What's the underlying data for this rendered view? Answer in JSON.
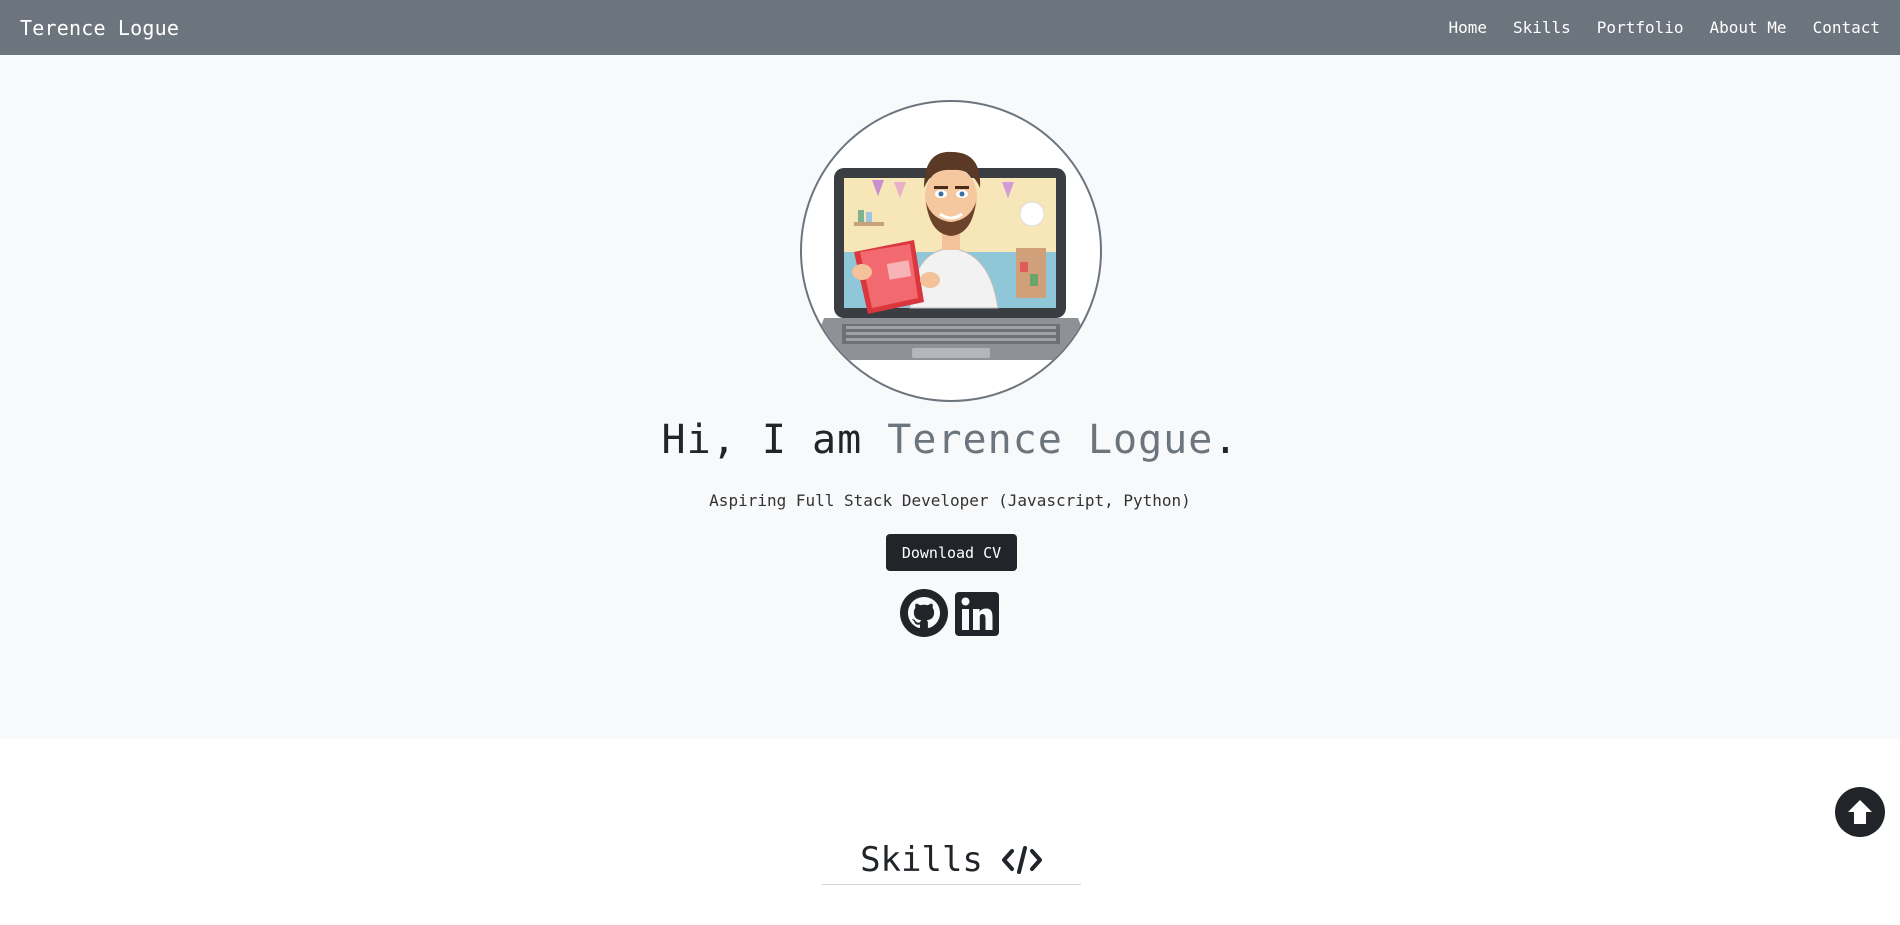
{
  "navbar": {
    "brand": "Terence Logue",
    "links": [
      {
        "label": "Home"
      },
      {
        "label": "Skills"
      },
      {
        "label": "Portfolio"
      },
      {
        "label": "About Me"
      },
      {
        "label": "Contact"
      }
    ]
  },
  "hero": {
    "greeting": "Hi, I am ",
    "name": "Terence Logue",
    "punctuation": ".",
    "subtitle": "Aspiring Full Stack Developer (Javascript, Python)",
    "cv_button": "Download CV",
    "social": [
      {
        "icon": "github-icon"
      },
      {
        "icon": "linkedin-icon"
      }
    ]
  },
  "skills": {
    "title": "Skills",
    "icon": "code-icon"
  },
  "scroll_top": {
    "icon": "arrow-up-icon"
  },
  "colors": {
    "navbar_bg": "#6c757d",
    "hero_bg": "#f8f9fa",
    "accent_name": "#6c757d",
    "button_bg": "#212529"
  }
}
